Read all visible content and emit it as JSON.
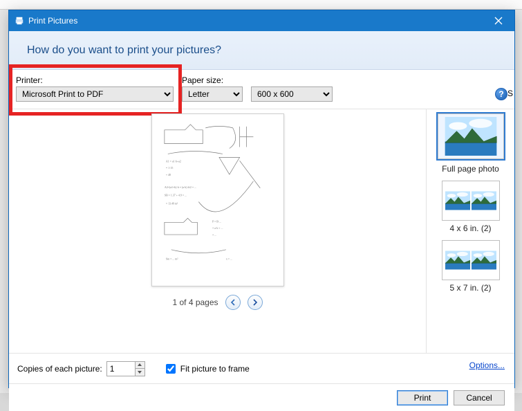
{
  "window": {
    "title": "Print Pictures"
  },
  "header": {
    "question": "How do you want to print your pictures?"
  },
  "toolbar": {
    "printer_label": "Printer:",
    "printer_value": "Microsoft Print to PDF",
    "paper_label": "Paper size:",
    "paper_value": "Letter",
    "quality_value": "600 x 600",
    "help_glyph": "?",
    "truncated_right": "S"
  },
  "preview": {
    "page_info": "1 of 4 pages"
  },
  "layouts": {
    "items": [
      {
        "label": "Full page photo",
        "selected": true,
        "cols": 1
      },
      {
        "label": "4 x 6 in. (2)",
        "selected": false,
        "cols": 2
      },
      {
        "label": "5 x 7 in. (2)",
        "selected": false,
        "cols": 2
      }
    ]
  },
  "bottom": {
    "copies_label": "Copies of each picture:",
    "copies_value": "1",
    "fit_label": "Fit picture to frame",
    "fit_checked": true,
    "options_link": "Options..."
  },
  "buttons": {
    "print": "Print",
    "cancel": "Cancel"
  }
}
